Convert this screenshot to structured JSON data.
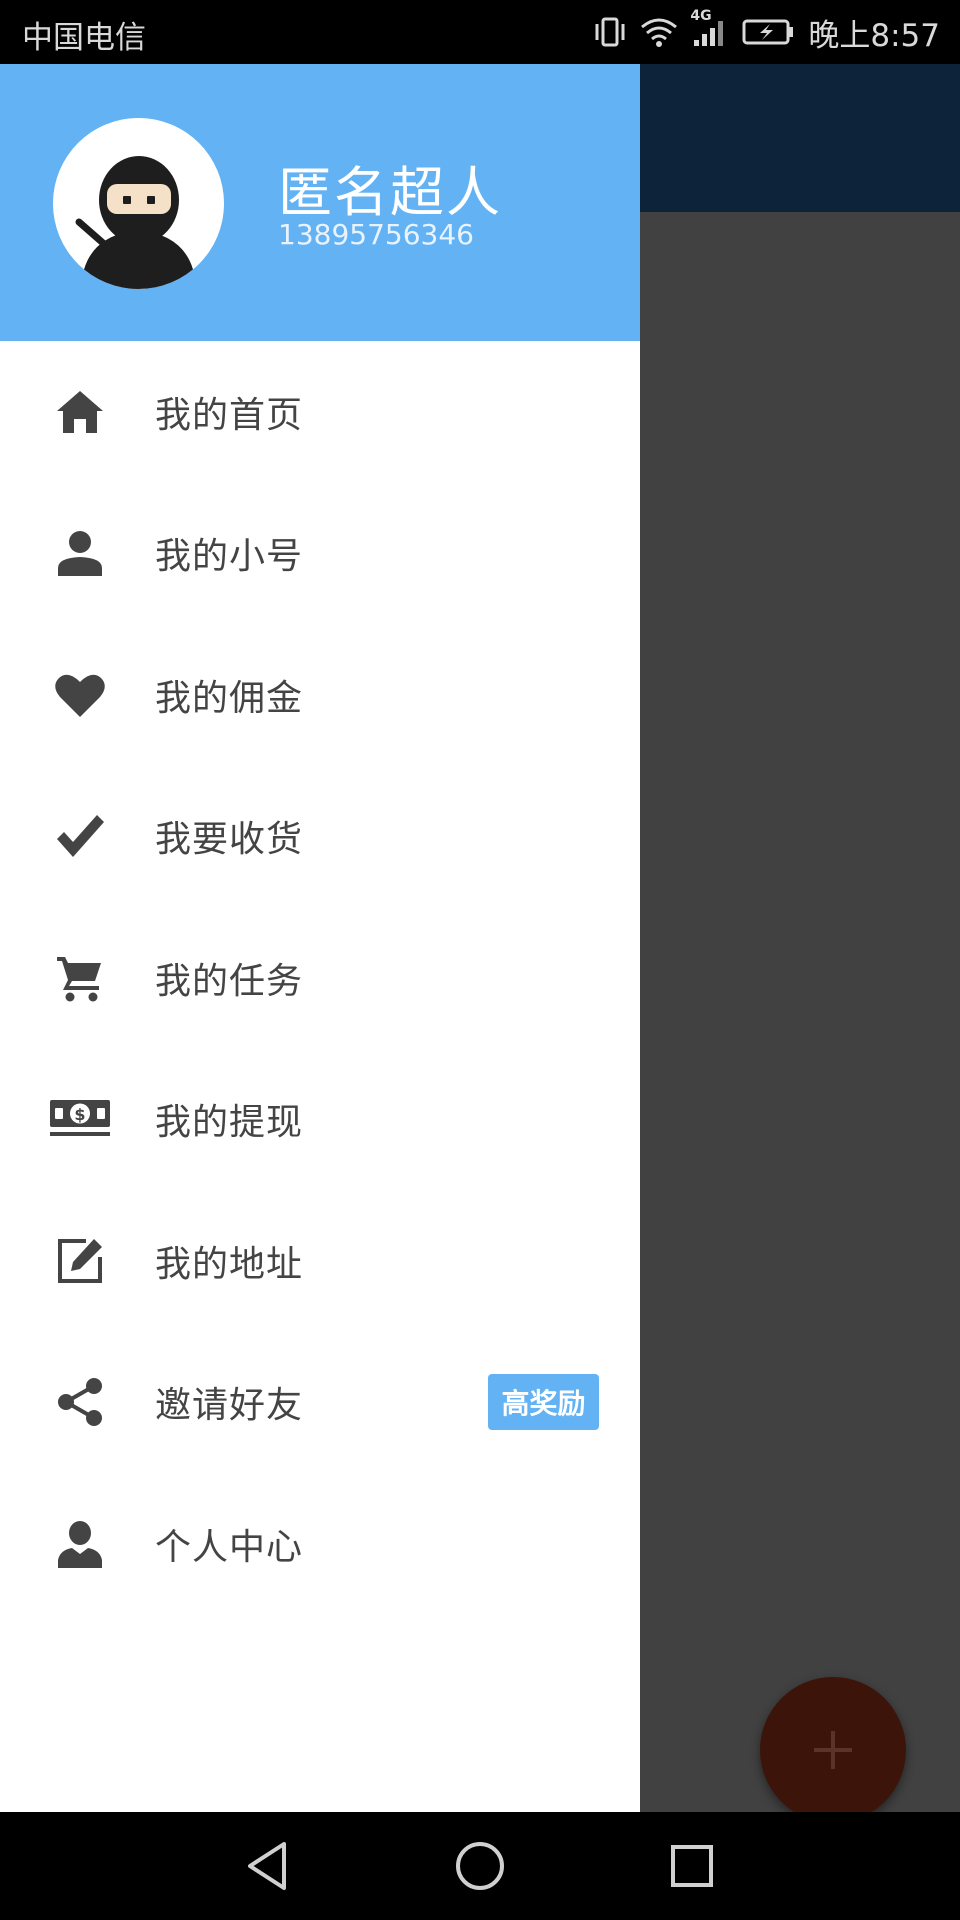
{
  "status_bar": {
    "carrier": "中国电信",
    "network": "4G",
    "time": "晚上8:57"
  },
  "drawer": {
    "header": {
      "user_name": "匿名超人",
      "phone": "13895756346",
      "background_color": "#63b2f4"
    },
    "menu_items": [
      {
        "label": "我的首页",
        "icon": "home-icon"
      },
      {
        "label": "我的小号",
        "icon": "person-icon"
      },
      {
        "label": "我的佣金",
        "icon": "heart-icon"
      },
      {
        "label": "我要收货",
        "icon": "check-icon"
      },
      {
        "label": "我的任务",
        "icon": "cart-icon"
      },
      {
        "label": "我的提现",
        "icon": "money-icon"
      },
      {
        "label": "我的地址",
        "icon": "edit-icon"
      },
      {
        "label": "邀请好友",
        "icon": "share-icon",
        "badge": "高奖励"
      },
      {
        "label": "个人中心",
        "icon": "user-icon"
      }
    ]
  },
  "fab": {
    "icon": "plus-icon"
  },
  "nav_bar": {
    "buttons": [
      "back-icon",
      "home-circle-icon",
      "recents-icon"
    ]
  }
}
